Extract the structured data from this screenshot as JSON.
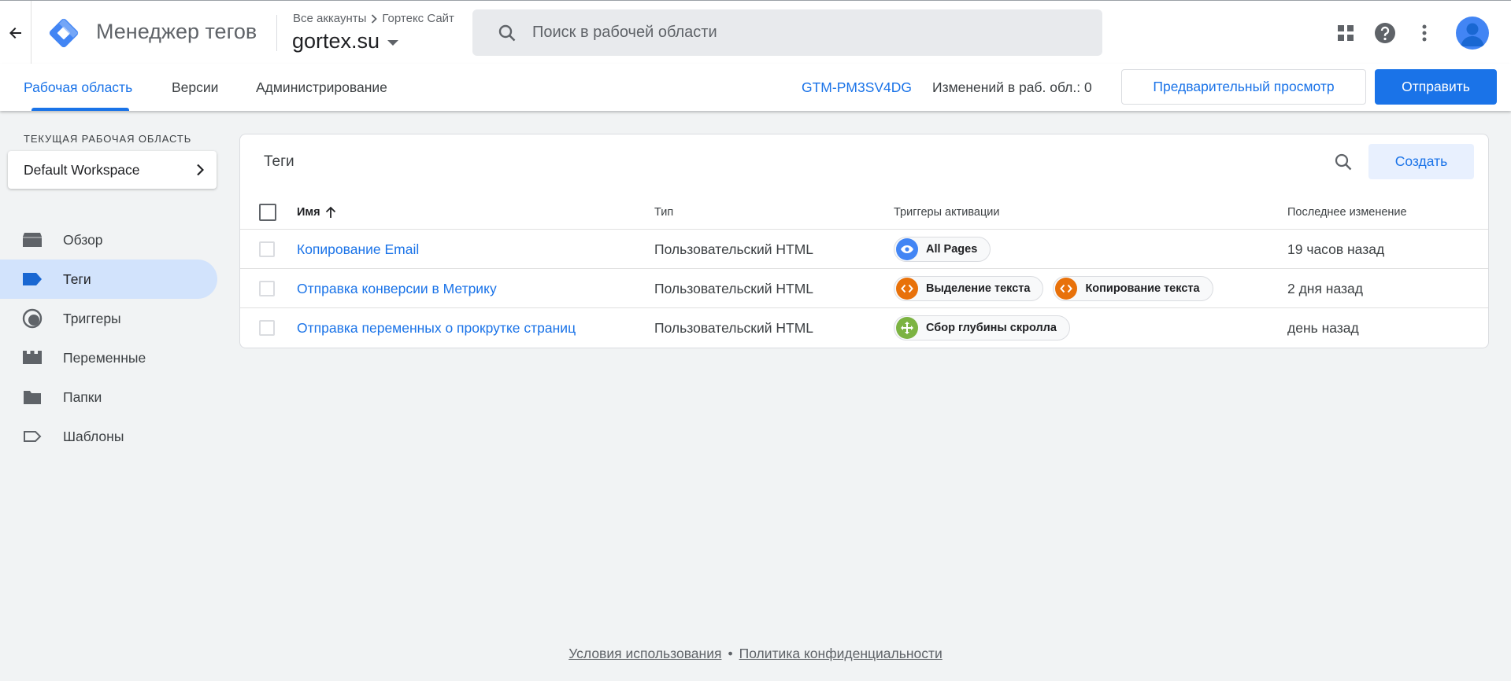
{
  "app": {
    "title": "Менеджер тегов",
    "breadcrumb": [
      "Все аккаунты",
      "Гортекс Сайт"
    ],
    "container": "gortex.su",
    "brand_color": "#1a73e8"
  },
  "search": {
    "placeholder": "Поиск в рабочей области"
  },
  "top_icons": [
    "apps-icon",
    "help-icon",
    "more-vert-icon",
    "account-avatar"
  ],
  "tabs": [
    {
      "label": "Рабочая область",
      "active": true
    },
    {
      "label": "Версии",
      "active": false
    },
    {
      "label": "Администрирование",
      "active": false
    }
  ],
  "header_right": {
    "container_id": "GTM-PM3SV4DG",
    "changes": "Изменений в раб. обл.: 0",
    "preview": "Предварительный просмотр",
    "submit": "Отправить"
  },
  "sidebar": {
    "workspace_label": "ТЕКУЩАЯ РАБОЧАЯ ОБЛАСТЬ",
    "workspace_name": "Default Workspace",
    "items": [
      {
        "label": "Обзор",
        "icon": "overview-icon",
        "active": false
      },
      {
        "label": "Теги",
        "icon": "tag-icon",
        "active": true
      },
      {
        "label": "Триггеры",
        "icon": "trigger-icon",
        "active": false
      },
      {
        "label": "Переменные",
        "icon": "variable-icon",
        "active": false
      },
      {
        "label": "Папки",
        "icon": "folder-icon",
        "active": false
      },
      {
        "label": "Шаблоны",
        "icon": "template-icon",
        "active": false
      }
    ]
  },
  "tags_panel": {
    "title": "Теги",
    "create": "Создать",
    "columns": [
      "Имя",
      "Тип",
      "Триггеры активации",
      "Последнее изменение"
    ],
    "rows": [
      {
        "name": "Копирование Email",
        "type": "Пользовательский HTML",
        "triggers": [
          {
            "label": "All Pages",
            "icon": "eye-icon",
            "color": "#4285f4"
          }
        ],
        "modified": "19 часов назад"
      },
      {
        "name": "Отправка конверсии в Метрику",
        "type": "Пользовательский HTML",
        "triggers": [
          {
            "label": "Выделение текста",
            "icon": "code-icon",
            "color": "#e8710a"
          },
          {
            "label": "Копирование текста",
            "icon": "code-icon",
            "color": "#e8710a"
          }
        ],
        "modified": "2 дня назад"
      },
      {
        "name": "Отправка переменных о прокрутке страниц",
        "type": "Пользовательский HTML",
        "triggers": [
          {
            "label": "Сбор глубины скролла",
            "icon": "move-icon",
            "color": "#7cb342"
          }
        ],
        "modified": "день назад"
      }
    ]
  },
  "footer": {
    "terms": "Условия использования",
    "separator": "•",
    "privacy": "Политика конфиденциальности"
  }
}
